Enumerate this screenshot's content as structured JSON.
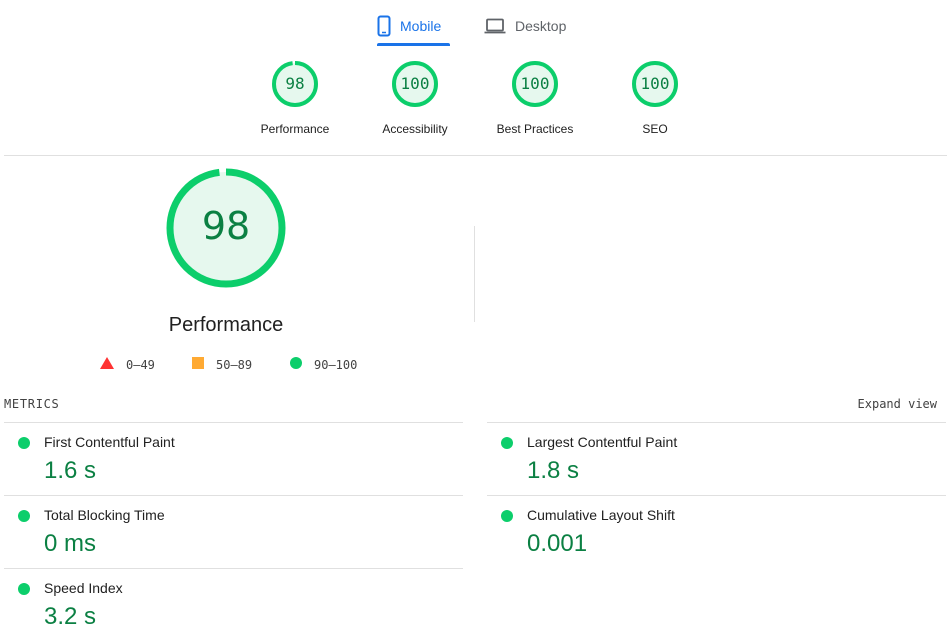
{
  "tabs": {
    "mobile": {
      "label": "Mobile",
      "icon": "phone-icon",
      "active": true,
      "color": "#1a73e8"
    },
    "desktop": {
      "label": "Desktop",
      "icon": "laptop-icon",
      "active": false
    }
  },
  "categories": [
    {
      "score": "98",
      "label": "Performance",
      "value": 98
    },
    {
      "score": "100",
      "label": "Accessibility",
      "value": 100
    },
    {
      "score": "100",
      "label": "Best Practices",
      "value": 100
    },
    {
      "score": "100",
      "label": "SEO",
      "value": 100
    }
  ],
  "performance": {
    "score": "98",
    "value": 98,
    "title": "Performance"
  },
  "legend": [
    {
      "range": "0–49",
      "shape": "triangle",
      "color": "#ff3333"
    },
    {
      "range": "50–89",
      "shape": "square",
      "color": "#ffaa33"
    },
    {
      "range": "90–100",
      "shape": "circle",
      "color": "#0cce6b"
    }
  ],
  "metrics": {
    "title": "METRICS",
    "expand_label": "Expand view",
    "items": [
      {
        "name": "First Contentful Paint",
        "value": "1.6 s"
      },
      {
        "name": "Largest Contentful Paint",
        "value": "1.8 s"
      },
      {
        "name": "Total Blocking Time",
        "value": "0 ms"
      },
      {
        "name": "Cumulative Layout Shift",
        "value": "0.001"
      },
      {
        "name": "Speed Index",
        "value": "3.2 s"
      }
    ]
  },
  "colors": {
    "good": "#0cce6b",
    "good_text": "#0b8043",
    "good_fill": "#e6f8ee"
  }
}
